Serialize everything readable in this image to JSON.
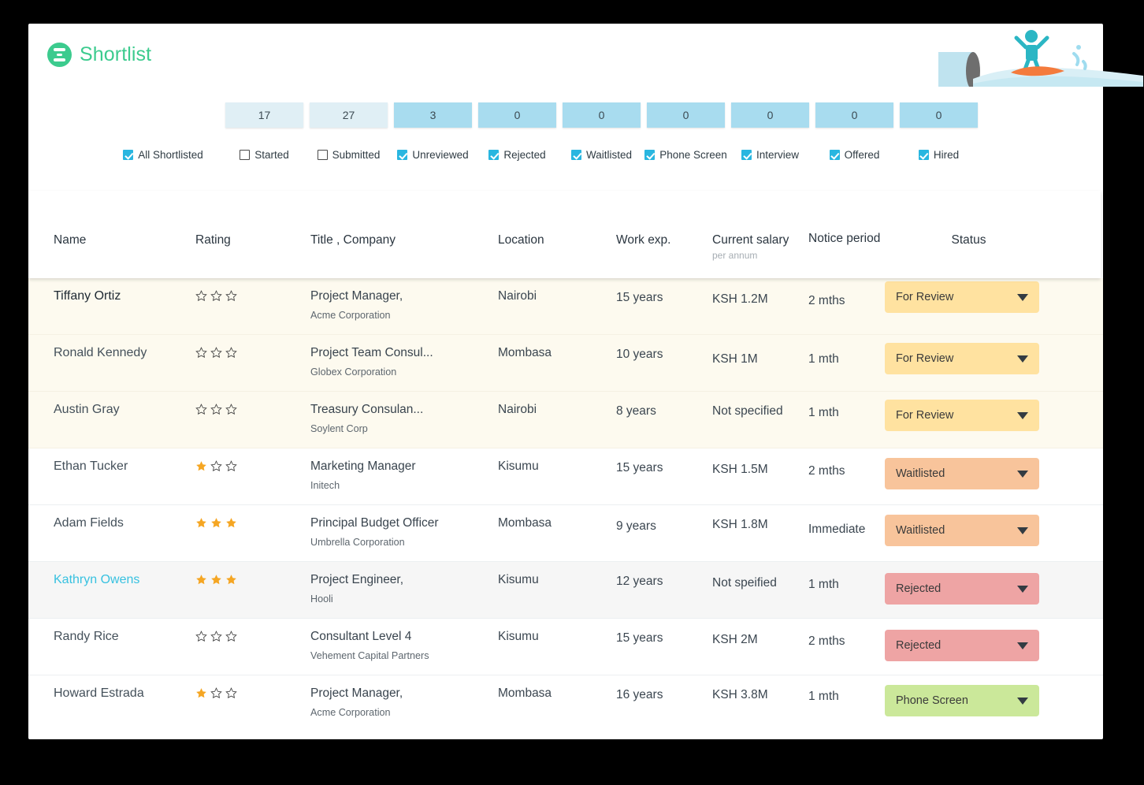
{
  "brand": {
    "name": "Shortlist",
    "logo_icon": "shortlist-logo-icon",
    "color": "#3ccb8e"
  },
  "filters": {
    "items": [
      {
        "count": "",
        "label": "All Shortlisted",
        "checked": true,
        "tile": "hidden"
      },
      {
        "count": "17",
        "label": "Started",
        "checked": false,
        "tile": "light"
      },
      {
        "count": "27",
        "label": "Submitted",
        "checked": false,
        "tile": "light"
      },
      {
        "count": "3",
        "label": "Unreviewed",
        "checked": true,
        "tile": "dark"
      },
      {
        "count": "0",
        "label": "Rejected",
        "checked": true,
        "tile": "dark"
      },
      {
        "count": "0",
        "label": "Waitlisted",
        "checked": true,
        "tile": "dark"
      },
      {
        "count": "0",
        "label": "Phone Screen",
        "checked": true,
        "tile": "dark"
      },
      {
        "count": "0",
        "label": "Interview",
        "checked": true,
        "tile": "dark"
      },
      {
        "count": "0",
        "label": "Offered",
        "checked": true,
        "tile": "dark"
      },
      {
        "count": "0",
        "label": "Hired",
        "checked": true,
        "tile": "dark"
      }
    ]
  },
  "illustration": {
    "name": "surfer-illustration",
    "board_color": "#f47b3d",
    "figure_color": "#2bb6c4",
    "wave_color": "#cfeaf2"
  },
  "table": {
    "columns": {
      "name": "Name",
      "rating": "Rating",
      "title_company": "Title , Company",
      "location": "Location",
      "work_exp": "Work exp.",
      "salary": "Current salary",
      "salary_sub": "per annum",
      "notice": "Notice period",
      "status": "Status"
    },
    "rows": [
      {
        "name": "Tiffany Ortiz",
        "name_style": "strong",
        "row_bg": "cream",
        "rating": 0,
        "title": "Project Manager,",
        "company": "Acme Corporation",
        "location": "Nairobi",
        "work_exp": "15 years",
        "salary": "KSH 1.2M",
        "notice": "2 mths",
        "status": "For Review",
        "status_style": "st-review"
      },
      {
        "name": "Ronald Kennedy",
        "name_style": "normal",
        "row_bg": "cream",
        "rating": 0,
        "title": "Project Team Consul...",
        "company": "Globex Corporation",
        "location": "Mombasa",
        "work_exp": "10 years",
        "salary": "KSH 1M",
        "notice": "1 mth",
        "status": "For Review",
        "status_style": "st-review"
      },
      {
        "name": "Austin Gray",
        "name_style": "normal",
        "row_bg": "cream",
        "rating": 0,
        "title": "Treasury Consulan...",
        "company": "Soylent Corp",
        "location": "Nairobi",
        "work_exp": "8 years",
        "salary": "Not specified",
        "notice": "1 mth",
        "status": "For Review",
        "status_style": "st-review"
      },
      {
        "name": "Ethan Tucker",
        "name_style": "normal",
        "row_bg": "white",
        "rating": 1,
        "title": "Marketing Manager",
        "company": "Initech",
        "location": "Kisumu",
        "work_exp": "15 years",
        "salary": "KSH 1.5M",
        "notice": "2 mths",
        "status": "Waitlisted",
        "status_style": "st-waitlist"
      },
      {
        "name": "Adam Fields",
        "name_style": "normal",
        "row_bg": "white",
        "rating": 3,
        "title": "Principal Budget Officer",
        "company": "Umbrella Corporation",
        "location": "Mombasa",
        "work_exp": "9 years",
        "salary": "KSH 1.8M",
        "notice": "Immediate",
        "status": "Waitlisted",
        "status_style": "st-waitlist"
      },
      {
        "name": "Kathryn Owens",
        "name_style": "link",
        "row_bg": "grey",
        "rating": 3,
        "title": "Project Engineer,",
        "company": "Hooli",
        "location": "Kisumu",
        "work_exp": "12 years",
        "salary": "Not speified",
        "notice": "1 mth",
        "status": "Rejected",
        "status_style": "st-rejected"
      },
      {
        "name": "Randy Rice",
        "name_style": "normal",
        "row_bg": "white",
        "rating": 0,
        "title": "Consultant Level 4",
        "company": "Vehement Capital Partners",
        "location": "Kisumu",
        "work_exp": "15 years",
        "salary": "KSH 2M",
        "notice": "2 mths",
        "status": "Rejected",
        "status_style": "st-rejected"
      },
      {
        "name": "Howard Estrada",
        "name_style": "normal",
        "row_bg": "white",
        "rating": 1,
        "title": "Project Manager,",
        "company": "Acme Corporation",
        "location": "Mombasa",
        "work_exp": "16 years",
        "salary": "KSH 3.8M",
        "notice": "1 mth",
        "status": "Phone Screen",
        "status_style": "st-phone"
      }
    ]
  },
  "colors": {
    "brand_green": "#3ccb8e",
    "checkbox_checked": "#29b6e0",
    "tile_light": "#e0eff5",
    "tile_dark": "#a8dcef",
    "star_filled": "#f5a623",
    "status_review": "#ffe2a0",
    "status_waitlisted": "#f8c49b",
    "status_rejected": "#eea4a4",
    "status_phone": "#cbe89a",
    "link": "#37c1e0"
  }
}
